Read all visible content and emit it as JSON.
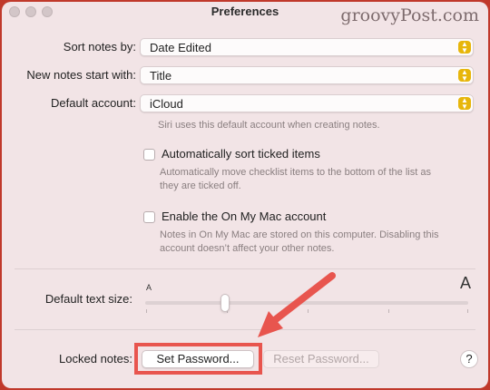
{
  "window": {
    "title": "Preferences",
    "watermark": "groovyPost.com"
  },
  "settings": {
    "sort": {
      "label": "Sort notes by:",
      "value": "Date Edited"
    },
    "new_notes": {
      "label": "New notes start with:",
      "value": "Title"
    },
    "account": {
      "label": "Default account:",
      "value": "iCloud",
      "hint": "Siri uses this default account when creating notes."
    },
    "auto_sort": {
      "label": "Automatically sort ticked items",
      "hint_line1": "Automatically move checklist items to the bottom of the list as",
      "hint_line2": "they are ticked off.",
      "checked": false
    },
    "on_my_mac": {
      "label": "Enable the On My Mac account",
      "hint_line1": "Notes in On My Mac are stored on this computer. Disabling this",
      "hint_line2": "account doesn’t affect your other notes.",
      "checked": false
    }
  },
  "text_size": {
    "label": "Default text size:",
    "small_glyph": "A",
    "large_glyph": "A",
    "level_fraction": 0.25
  },
  "locked_notes": {
    "label": "Locked notes:",
    "set_password": "Set Password...",
    "reset_password": "Reset Password..."
  },
  "help": {
    "glyph": "?"
  },
  "colors": {
    "accent": "#e7b60b",
    "annotation": "#e8554e",
    "background": "#f2e4e6"
  }
}
